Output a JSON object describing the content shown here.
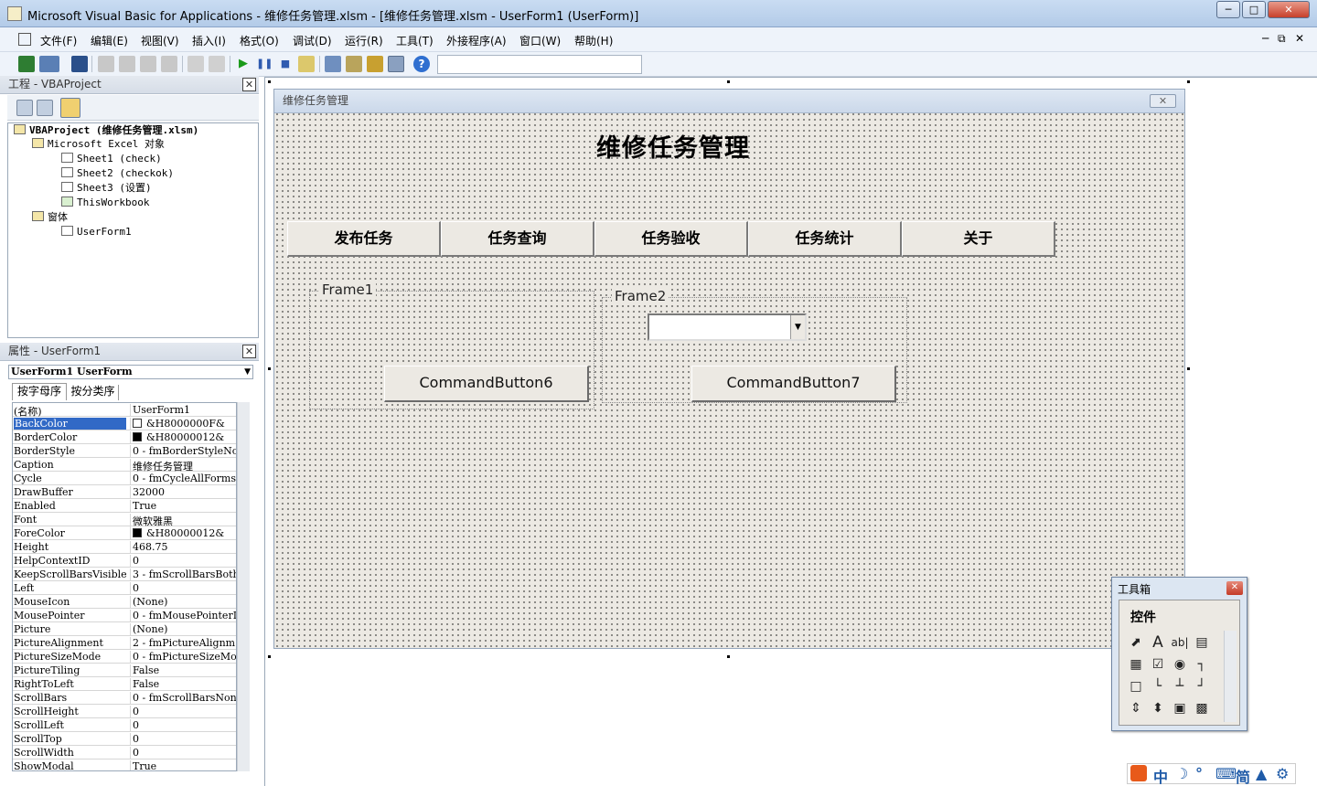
{
  "window": {
    "title": "Microsoft Visual Basic for Applications - 维修任务管理.xlsm - [维修任务管理.xlsm - UserForm1 (UserForm)]"
  },
  "menu": [
    "文件(F)",
    "编辑(E)",
    "视图(V)",
    "插入(I)",
    "格式(O)",
    "调试(D)",
    "运行(R)",
    "工具(T)",
    "外接程序(A)",
    "窗口(W)",
    "帮助(H)"
  ],
  "project": {
    "title": "工程 - VBAProject",
    "tree": [
      "VBAProject (维修任务管理.xlsm)",
      "Microsoft Excel 对象",
      "Sheet1 (check)",
      "Sheet2 (checkok)",
      "Sheet3 (设置)",
      "ThisWorkbook",
      "窗体",
      "UserForm1"
    ]
  },
  "properties": {
    "title": "属性 - UserForm1",
    "object": "UserForm1 UserForm",
    "tabs": [
      "按字母序",
      "按分类序"
    ],
    "rows": [
      {
        "name": "(名称)",
        "value": "UserForm1"
      },
      {
        "name": "BackColor",
        "value": "&H8000000F&"
      },
      {
        "name": "BorderColor",
        "value": "&H80000012&"
      },
      {
        "name": "BorderStyle",
        "value": "0 - fmBorderStyleNo"
      },
      {
        "name": "Caption",
        "value": "维修任务管理"
      },
      {
        "name": "Cycle",
        "value": "0 - fmCycleAllForms"
      },
      {
        "name": "DrawBuffer",
        "value": "32000"
      },
      {
        "name": "Enabled",
        "value": "True"
      },
      {
        "name": "Font",
        "value": "微软雅黑"
      },
      {
        "name": "ForeColor",
        "value": "&H80000012&"
      },
      {
        "name": "Height",
        "value": "468.75"
      },
      {
        "name": "HelpContextID",
        "value": "0"
      },
      {
        "name": "KeepScrollBarsVisible",
        "value": "3 - fmScrollBarsBoth"
      },
      {
        "name": "Left",
        "value": "0"
      },
      {
        "name": "MouseIcon",
        "value": "(None)"
      },
      {
        "name": "MousePointer",
        "value": "0 - fmMousePointerDe"
      },
      {
        "name": "Picture",
        "value": "(None)"
      },
      {
        "name": "PictureAlignment",
        "value": "2 - fmPictureAlignm"
      },
      {
        "name": "PictureSizeMode",
        "value": "0 - fmPictureSizeMo"
      },
      {
        "name": "PictureTiling",
        "value": "False"
      },
      {
        "name": "RightToLeft",
        "value": "False"
      },
      {
        "name": "ScrollBars",
        "value": "0 - fmScrollBarsNon"
      },
      {
        "name": "ScrollHeight",
        "value": "0"
      },
      {
        "name": "ScrollLeft",
        "value": "0"
      },
      {
        "name": "ScrollTop",
        "value": "0"
      },
      {
        "name": "ScrollWidth",
        "value": "0"
      },
      {
        "name": "ShowModal",
        "value": "True"
      }
    ]
  },
  "form": {
    "title": "维修任务管理",
    "heading": "维修任务管理",
    "tabs": [
      "发布任务",
      "任务查询",
      "任务验收",
      "任务统计",
      "关于"
    ],
    "frame1": {
      "label": "Frame1",
      "button": "CommandButton6"
    },
    "frame2": {
      "label": "Frame2",
      "button": "CommandButton7"
    }
  },
  "toolbox": {
    "title": "工具箱",
    "tab": "控件"
  },
  "ime": [
    "中",
    "简"
  ],
  "colors": {
    "selection": "#3169c6",
    "form_bg": "#ece9e3"
  }
}
